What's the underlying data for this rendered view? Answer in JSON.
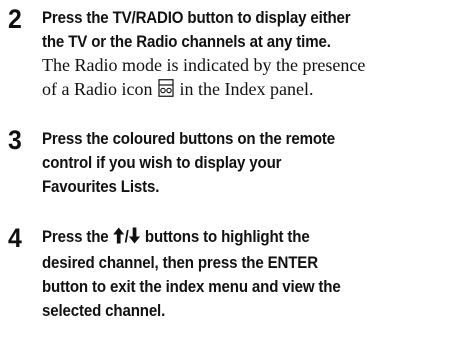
{
  "steps": [
    {
      "number": "2",
      "instruction_line1": "Press the TV/RADIO button to display either",
      "instruction_line2": "the TV or the Radio channels at any time.",
      "note_line1": "The Radio mode is indicated by the presence",
      "note_line2_pre": "of a Radio icon",
      "note_line2_post": "in the Index panel.",
      "icon": "radio-icon"
    },
    {
      "number": "3",
      "instruction_line1": "Press the coloured buttons on the remote",
      "instruction_line2": "control if you wish to display your",
      "instruction_line3": "Favourites Lists."
    },
    {
      "number": "4",
      "instruction_line1_pre": "Press the",
      "arrow_separator": "/",
      "instruction_line1_post": "buttons to highlight the",
      "instruction_line2": "desired channel, then press the ENTER",
      "instruction_line3": "button to exit the index menu and view the",
      "instruction_line4": "selected channel.",
      "icons": [
        "arrow-up-icon",
        "arrow-down-icon"
      ]
    }
  ]
}
